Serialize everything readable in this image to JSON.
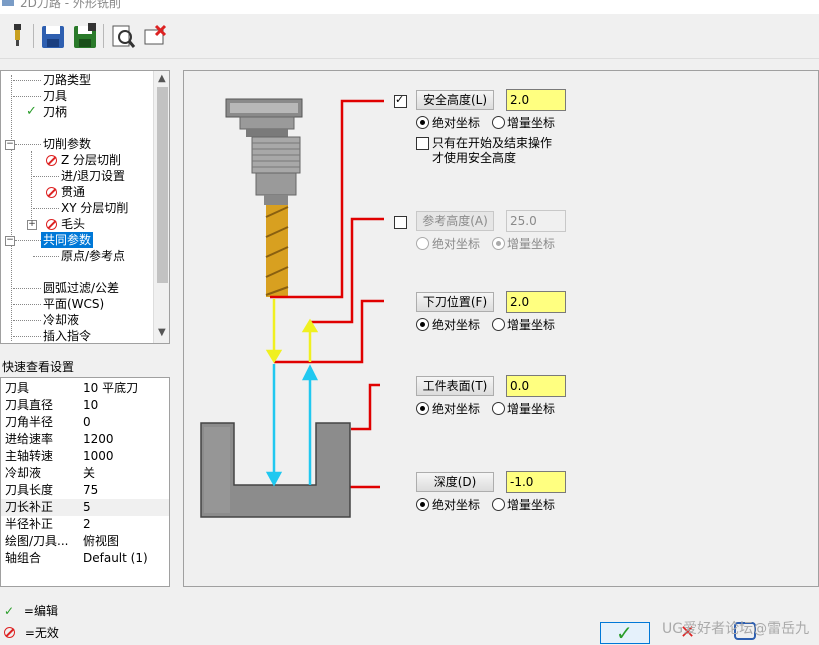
{
  "window": {
    "title": "2D刀路 - 外形铣削"
  },
  "toolbar": {
    "icons": [
      "tool-icon",
      "save-icon",
      "save-all-icon",
      "preview-icon",
      "clear-icon"
    ]
  },
  "tree": {
    "items": [
      {
        "label": "刀路类型",
        "status": ""
      },
      {
        "label": "刀具",
        "status": ""
      },
      {
        "label": "刀柄",
        "status": "edited"
      },
      {
        "label": "切削参数",
        "status": ""
      },
      {
        "label": "Z 分层切削",
        "status": "disabled"
      },
      {
        "label": "进/退刀设置",
        "status": ""
      },
      {
        "label": "贯通",
        "status": "disabled"
      },
      {
        "label": "XY 分层切削",
        "status": ""
      },
      {
        "label": "毛头",
        "status": "disabled"
      },
      {
        "label": "共同参数",
        "status": "selected"
      },
      {
        "label": "原点/参考点",
        "status": ""
      },
      {
        "label": "圆弧过滤/公差",
        "status": ""
      },
      {
        "label": "平面(WCS)",
        "status": ""
      },
      {
        "label": "冷却液",
        "status": ""
      },
      {
        "label": "插入指令",
        "status": ""
      }
    ]
  },
  "quick_view": {
    "title": "快速查看设置",
    "rows": [
      {
        "key": "刀具",
        "value": "10 平底刀"
      },
      {
        "key": "刀具直径",
        "value": "10"
      },
      {
        "key": "刀角半径",
        "value": "0"
      },
      {
        "key": "进给速率",
        "value": "1200"
      },
      {
        "key": "主轴转速",
        "value": "1000"
      },
      {
        "key": "冷却液",
        "value": "关"
      },
      {
        "key": "刀具长度",
        "value": "75"
      },
      {
        "key": "刀长补正",
        "value": "5"
      },
      {
        "key": "半径补正",
        "value": "2"
      },
      {
        "key": "绘图/刀具...",
        "value": "俯视图"
      },
      {
        "key": "轴组合",
        "value": "Default (1)"
      }
    ]
  },
  "legend": {
    "edited": "=编辑",
    "disabled": "=无效"
  },
  "params": {
    "clearance": {
      "label": "安全高度(L)",
      "value": "2.0",
      "enabled": true,
      "abs_label": "绝对坐标",
      "inc_label": "增量坐标",
      "mode": "abs",
      "only_start_end_line1": "只有在开始及结束操作",
      "only_start_end_line2": "才使用安全高度"
    },
    "retract": {
      "label": "参考高度(A)",
      "value": "25.0",
      "enabled": false,
      "abs_label": "绝对坐标",
      "inc_label": "增量坐标",
      "mode": "inc"
    },
    "feed_plane": {
      "label": "下刀位置(F)",
      "value": "2.0",
      "abs_label": "绝对坐标",
      "inc_label": "增量坐标",
      "mode": "abs"
    },
    "top_of_stock": {
      "label": "工件表面(T)",
      "value": "0.0",
      "abs_label": "绝对坐标",
      "inc_label": "增量坐标",
      "mode": "abs"
    },
    "depth": {
      "label": "深度(D)",
      "value": "-1.0",
      "abs_label": "绝对坐标",
      "inc_label": "增量坐标",
      "mode": "abs"
    }
  },
  "footer": {
    "ok_icon": "check-icon",
    "watermark": "UG爱好者论坛@雷岳九"
  },
  "colors": {
    "yellow_field": "#ffff80",
    "red_line": "#e00000",
    "cyan_arrow": "#20c8f0",
    "yellow_arrow": "#f0f020",
    "selected": "#0078d7"
  }
}
